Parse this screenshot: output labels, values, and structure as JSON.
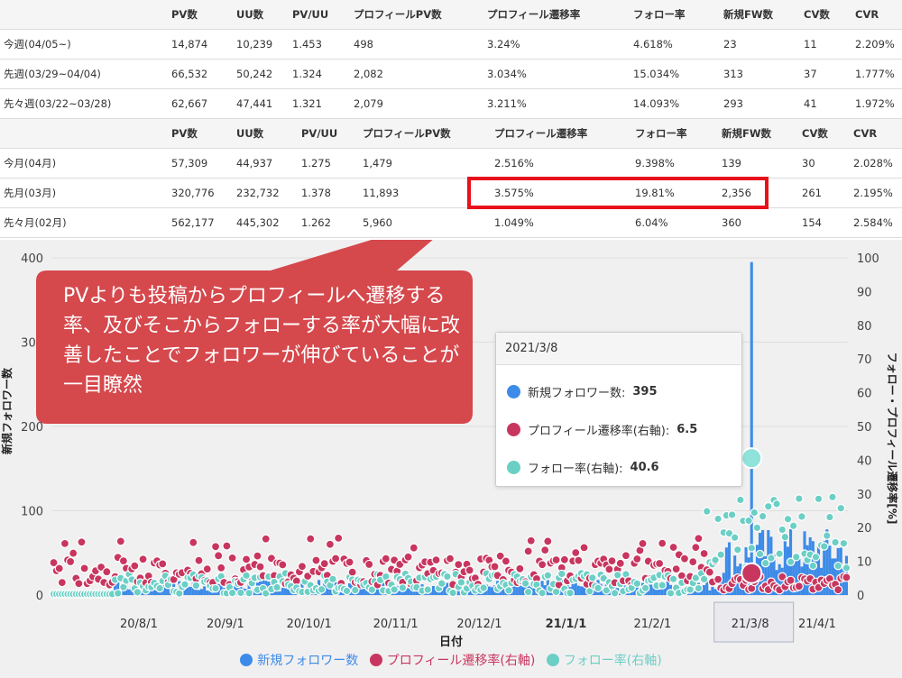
{
  "weekly_table": {
    "headers": [
      "",
      "PV数",
      "UU数",
      "PV/UU",
      "プロフィールPV数",
      "プロフィール遷移率",
      "フォロー率",
      "新規FW数",
      "CV数",
      "CVR"
    ],
    "rows": [
      [
        "今週(04/05~)",
        "14,874",
        "10,239",
        "1.453",
        "498",
        "3.24%",
        "4.618%",
        "23",
        "11",
        "2.209%"
      ],
      [
        "先週(03/29~04/04)",
        "66,532",
        "50,242",
        "1.324",
        "2,082",
        "3.034%",
        "15.034%",
        "313",
        "37",
        "1.777%"
      ],
      [
        "先々週(03/22~03/28)",
        "62,667",
        "47,441",
        "1.321",
        "2,079",
        "3.211%",
        "14.093%",
        "293",
        "41",
        "1.972%"
      ]
    ]
  },
  "monthly_table": {
    "headers": [
      "",
      "PV数",
      "UU数",
      "PV/UU",
      "プロフィールPV数",
      "プロフィール遷移率",
      "フォロー率",
      "新規FW数",
      "CV数",
      "CVR"
    ],
    "rows": [
      [
        "今月(04月)",
        "57,309",
        "44,937",
        "1.275",
        "1,479",
        "2.516%",
        "9.398%",
        "139",
        "30",
        "2.028%"
      ],
      [
        "先月(03月)",
        "320,776",
        "232,732",
        "1.378",
        "11,893",
        "3.575%",
        "19.81%",
        "2,356",
        "261",
        "2.195%"
      ],
      [
        "先々月(02月)",
        "562,177",
        "445,302",
        "1.262",
        "5,960",
        "1.049%",
        "6.04%",
        "360",
        "154",
        "2.584%"
      ]
    ]
  },
  "callout": {
    "text": "PVよりも投稿からプロフィールへ遷移する率、及びそこからフォローする率が大幅に改善したことでフォロワーが伸びていることが一目瞭然"
  },
  "tooltip": {
    "date": "2021/3/8",
    "items": [
      {
        "label": "新規フォロワー数:",
        "value": "395",
        "color": "#3d8be8"
      },
      {
        "label": "プロフィール遷移率(右軸):",
        "value": "6.5",
        "color": "#c8365f"
      },
      {
        "label": "フォロー率(右軸):",
        "value": "40.6",
        "color": "#6ccfc5"
      }
    ]
  },
  "chart_data": {
    "type": "line",
    "xlabel": "日付",
    "ylabel_left": "新規フォロワー数",
    "ylabel_right": "フォロー・プロフィール遷移率[%]",
    "ylim_left": [
      0,
      400
    ],
    "ylim_right": [
      0,
      100
    ],
    "left_ticks": [
      "0",
      "100",
      "200",
      "300",
      "400"
    ],
    "right_ticks": [
      "0",
      "10",
      "20",
      "30",
      "40",
      "50",
      "60",
      "70",
      "80",
      "90",
      "100"
    ],
    "x_ticks": [
      "20/8/1",
      "20/9/1",
      "20/10/1",
      "20/11/1",
      "20/12/1",
      "21/1/1",
      "21/2/1",
      "21/3/8",
      "21/4/1"
    ],
    "x_tick_bold": "21/1/1",
    "x_tick_highlight": "21/3/8",
    "x_range": [
      "2020-07-01",
      "2021-04-12"
    ],
    "series": [
      {
        "name": "新規フォロワー数",
        "axis": "left",
        "color": "#3d8be8"
      },
      {
        "name": "プロフィール遷移率(右軸)",
        "axis": "right",
        "color": "#c8365f"
      },
      {
        "name": "フォロー率(右軸)",
        "axis": "right",
        "color": "#6ccfc5"
      }
    ],
    "highlight_point": {
      "date": "2021-03-08",
      "新規フォロワー数": 395,
      "プロフィール遷移率(右軸)": 6.5,
      "フォロー率(右軸)": 40.6
    }
  },
  "legend": {
    "items": [
      {
        "label": "新規フォロワー数",
        "color": "#3d8be8"
      },
      {
        "label": "プロフィール遷移率(右軸)",
        "color": "#c8365f"
      },
      {
        "label": "フォロー率(右軸)",
        "color": "#6ccfc5"
      }
    ]
  },
  "colors": {
    "callout_bg": "#d5484c",
    "highlight_border": "#e8101a",
    "chart_bg": "#f1f0f1"
  }
}
